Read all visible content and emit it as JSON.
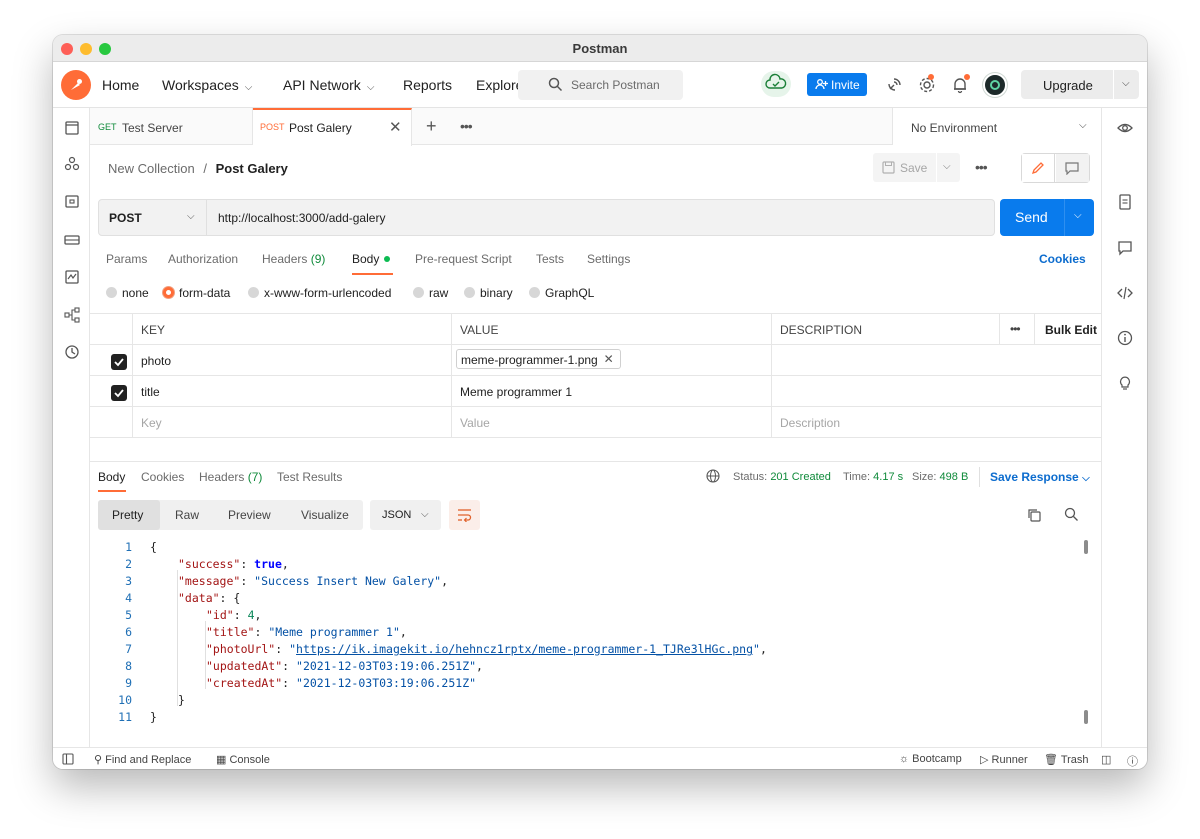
{
  "window": {
    "title": "Postman"
  },
  "nav": {
    "items": [
      {
        "label": "Home",
        "has_chevron": false
      },
      {
        "label": "Workspaces",
        "has_chevron": true
      },
      {
        "label": "API Network",
        "has_chevron": true
      },
      {
        "label": "Reports",
        "has_chevron": false
      },
      {
        "label": "Explore",
        "has_chevron": false
      }
    ],
    "search_placeholder": "Search Postman",
    "invite_label": "Invite",
    "upgrade_label": "Upgrade"
  },
  "tabs": [
    {
      "method": "GET",
      "name": "Test Server",
      "active": false
    },
    {
      "method": "POST",
      "name": "Post Galery",
      "active": true
    }
  ],
  "environment": {
    "selected": "No Environment"
  },
  "breadcrumb": {
    "collection": "New Collection",
    "separator": "/",
    "request": "Post Galery"
  },
  "toolbar": {
    "save_label": "Save"
  },
  "request": {
    "method": "POST",
    "url": "http://localhost:3000/add-galery",
    "send_label": "Send"
  },
  "request_tabs": [
    {
      "label": "Params",
      "count": ""
    },
    {
      "label": "Authorization",
      "count": ""
    },
    {
      "label": "Headers",
      "count": "(9)"
    },
    {
      "label": "Body",
      "count": ""
    },
    {
      "label": "Pre-request Script",
      "count": ""
    },
    {
      "label": "Tests",
      "count": ""
    },
    {
      "label": "Settings",
      "count": ""
    }
  ],
  "cookies_link": "Cookies",
  "body_types": [
    {
      "label": "none",
      "selected": false
    },
    {
      "label": "form-data",
      "selected": true
    },
    {
      "label": "x-www-form-urlencoded",
      "selected": false
    },
    {
      "label": "raw",
      "selected": false
    },
    {
      "label": "binary",
      "selected": false
    },
    {
      "label": "GraphQL",
      "selected": false
    }
  ],
  "form_table": {
    "headers": {
      "key": "KEY",
      "value": "VALUE",
      "description": "DESCRIPTION",
      "bulk_edit": "Bulk Edit"
    },
    "rows": [
      {
        "checked": true,
        "key": "photo",
        "value": "meme-programmer-1.png",
        "is_file": true
      },
      {
        "checked": true,
        "key": "title",
        "value": "Meme programmer 1",
        "is_file": false
      }
    ],
    "placeholders": {
      "key": "Key",
      "value": "Value",
      "description": "Description"
    }
  },
  "response": {
    "tabs": [
      {
        "label": "Body",
        "count": ""
      },
      {
        "label": "Cookies",
        "count": ""
      },
      {
        "label": "Headers",
        "count": "(7)"
      },
      {
        "label": "Test Results",
        "count": ""
      }
    ],
    "status_label": "Status:",
    "status_value": "201 Created",
    "time_label": "Time:",
    "time_value": "4.17 s",
    "size_label": "Size:",
    "size_value": "498 B",
    "save_label": "Save Response",
    "view_tabs": [
      "Pretty",
      "Raw",
      "Preview",
      "Visualize"
    ],
    "format": "JSON",
    "code": {
      "line_numbers": [
        "1",
        "2",
        "3",
        "4",
        "5",
        "6",
        "7",
        "8",
        "9",
        "10",
        "11"
      ],
      "open_brace": "{",
      "close_brace": "}",
      "success_key": "\"success\"",
      "success_val": "true",
      "message_key": "\"message\"",
      "message_val": "\"Success Insert New Galery\"",
      "data_key": "\"data\"",
      "id_key": "\"id\"",
      "id_val": "4",
      "title_key": "\"title\"",
      "title_val": "\"Meme programmer 1\"",
      "photo_key": "\"photoUrl\"",
      "photo_val": "https://ik.imagekit.io/hehncz1rptx/meme-programmer-1_TJRe3lHGc.png",
      "updated_key": "\"updatedAt\"",
      "updated_val": "\"2021-12-03T03:19:06.251Z\"",
      "created_key": "\"createdAt\"",
      "created_val": "\"2021-12-03T03:19:06.251Z\""
    }
  },
  "footer": {
    "find_replace": "Find and Replace",
    "console": "Console",
    "bootcamp": "Bootcamp",
    "runner": "Runner",
    "trash": "Trash"
  },
  "colors": {
    "brand": "#ff6c37",
    "primary": "#097bed",
    "success": "#0f8a3a"
  }
}
